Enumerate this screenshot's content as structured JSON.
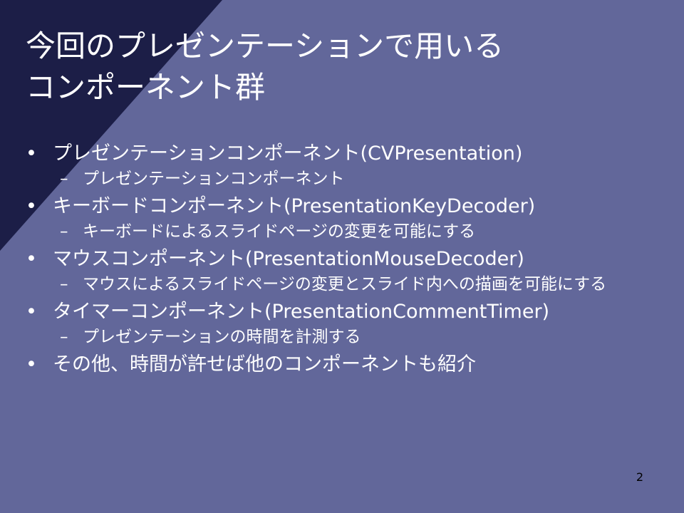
{
  "slide": {
    "title": "今回のプレゼンテーションで用いる\nコンポーネント群",
    "bullets": [
      {
        "text": "プレゼンテーションコンポーネント(CVPresentation)",
        "subs": [
          "プレゼンテーションコンポーネント"
        ]
      },
      {
        "text": "キーボードコンポーネント(PresentationKeyDecoder)",
        "subs": [
          "キーボードによるスライドページの変更を可能にする"
        ]
      },
      {
        "text": "マウスコンポーネント(PresentationMouseDecoder)",
        "subs": [
          "マウスによるスライドページの変更とスライド内への描画を可能にする"
        ]
      },
      {
        "text": "タイマーコンポーネント(PresentationCommentTimer)",
        "subs": [
          "プレゼンテーションの時間を計測する"
        ]
      },
      {
        "text": "その他、時間が許せば他のコンポーネントも紹介",
        "subs": []
      }
    ],
    "page_number": "2"
  },
  "theme": {
    "background": "#62679a",
    "corner": "#1c1e47",
    "text": "#ffffff",
    "page_number_color": "#000000"
  }
}
